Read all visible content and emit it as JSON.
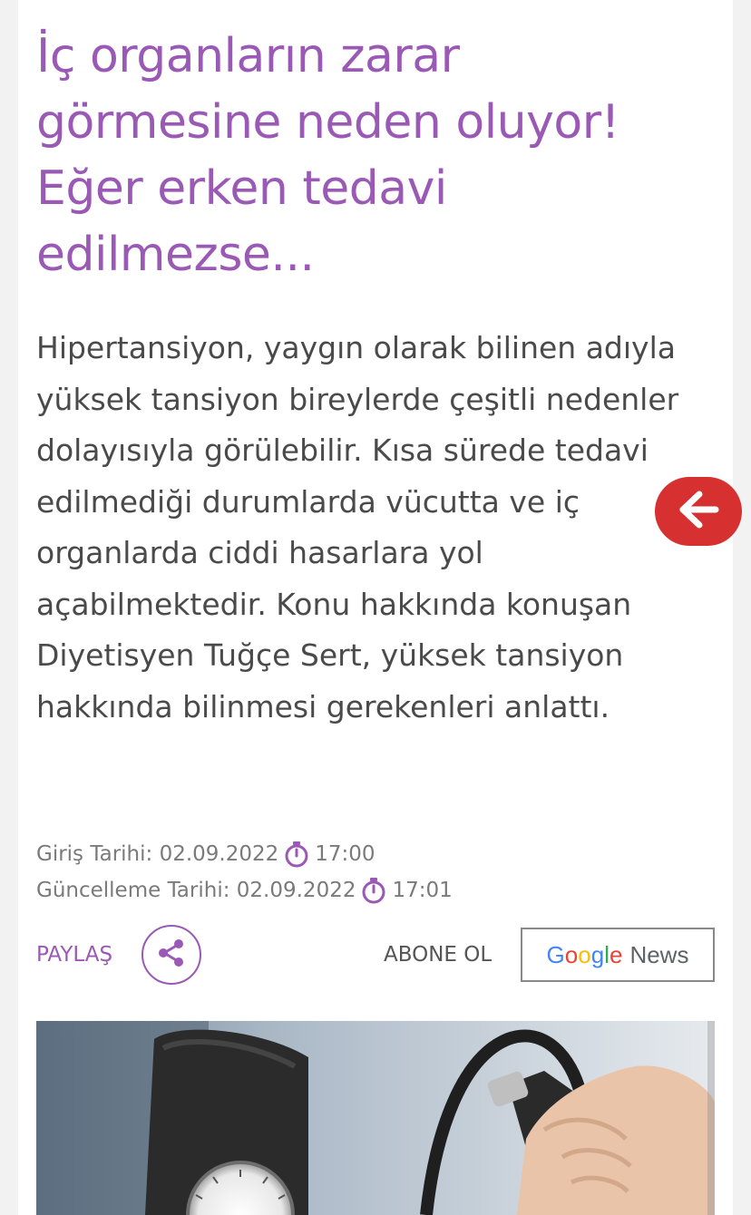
{
  "article": {
    "title": "İç organların zarar görmesine neden oluyor! Eğer erken tedavi edilmezse...",
    "summary": "Hipertansiyon, yaygın olarak bilinen adıyla yüksek tansiyon bireylerde çeşitli nedenler dolayısıyla görülebilir. Kısa sürede tedavi edilmediği durumlarda vücutta ve iç organlarda ciddi hasarlara yol açabilmektedir. Konu hakkında konuşan Diyetisyen Tuğçe Sert, yüksek tansiyon hakkında bilinmesi gerekenleri anlattı."
  },
  "meta": {
    "published_label": "Giriş Tarihi:",
    "published_date": "02.09.2022",
    "published_time": "17:00",
    "updated_label": "Güncelleme Tarihi:",
    "updated_date": "02.09.2022",
    "updated_time": "17:01"
  },
  "actions": {
    "share_label": "PAYLAŞ",
    "subscribe_label": "ABONE OL",
    "google_news": {
      "letters": [
        "G",
        "o",
        "o",
        "g",
        "l",
        "e"
      ],
      "news": "News"
    }
  },
  "icons": {
    "clock": "clock-icon",
    "share": "share-icon",
    "back": "arrow-left-icon"
  },
  "colors": {
    "accent": "#9b59b6",
    "fab": "#d63031",
    "text": "#4a4a4a",
    "meta": "#7a7a7a",
    "google": [
      "#4285F4",
      "#EA4335",
      "#FBBC05",
      "#4285F4",
      "#34A853",
      "#EA4335"
    ]
  }
}
